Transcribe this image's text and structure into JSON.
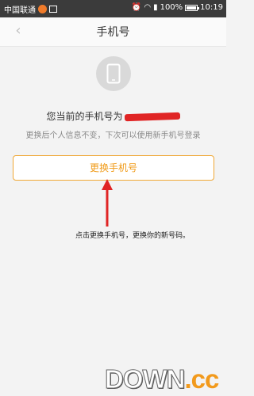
{
  "status_bar": {
    "carrier": "中国联通",
    "battery": "100%",
    "time": "10:19"
  },
  "nav": {
    "title": "手机号",
    "back_icon": "chevron-left-icon"
  },
  "content": {
    "current_number_label": "您当前的手机号为",
    "hint": "更换后个人信息不变，下次可以使用新手机号登录",
    "change_button_label": "更换手机号"
  },
  "annotation": {
    "text": "点击更换手机号，更换你的新号码。"
  },
  "watermark": {
    "text_main": "DOWN",
    "text_suffix": ".cc"
  },
  "colors": {
    "accent": "#f09a17",
    "status_bar": "#3b3b3b",
    "annotation_arrow": "#e02424"
  }
}
